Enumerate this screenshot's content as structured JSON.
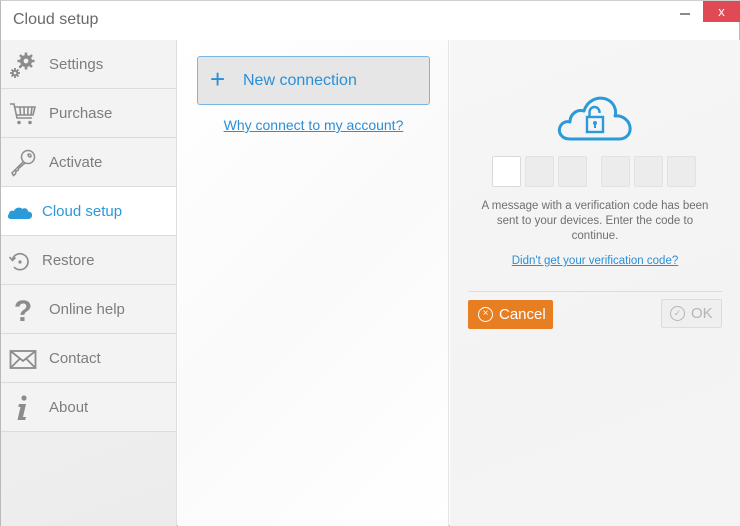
{
  "window": {
    "title": "Cloud setup",
    "minimize_label": "–",
    "close_label": "x"
  },
  "sidebar": {
    "items": [
      {
        "label": "Settings",
        "icon": "gears-icon",
        "active": false
      },
      {
        "label": "Purchase",
        "icon": "cart-icon",
        "active": false
      },
      {
        "label": "Activate",
        "icon": "key-icon",
        "active": false
      },
      {
        "label": "Cloud setup",
        "icon": "cloud-icon",
        "active": true
      },
      {
        "label": "Restore",
        "icon": "restore-icon",
        "active": false
      },
      {
        "label": "Online help",
        "icon": "question-icon",
        "active": false
      },
      {
        "label": "Contact",
        "icon": "envelope-icon",
        "active": false
      },
      {
        "label": "About",
        "icon": "info-icon",
        "active": false
      }
    ]
  },
  "middle": {
    "new_connection_icon": "+",
    "new_connection_label": "New connection",
    "why_link": "Why connect to my account?"
  },
  "verification": {
    "code_digits": [
      "",
      "",
      "",
      "",
      "",
      ""
    ],
    "message": "A message with a verification code has been sent to your devices. Enter the code to continue.",
    "didnt_get_link": "Didn't get your verification code?",
    "cancel_label": "Cancel",
    "cancel_icon": "×",
    "ok_label": "OK",
    "ok_icon": "✓",
    "ok_enabled": false
  },
  "colors": {
    "accent": "#2b8fd6",
    "cancel": "#e87e22",
    "close": "#e04a55"
  }
}
